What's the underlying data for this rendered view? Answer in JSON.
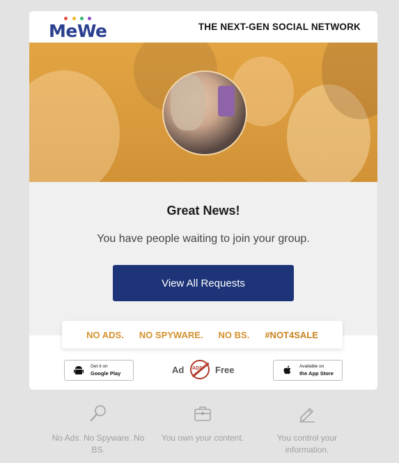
{
  "brand": {
    "logo_text": "MeWe",
    "logo_dot_colors": [
      "#e64b3c",
      "#f0b429",
      "#2db86b",
      "#8b46c9",
      "#3b82f6"
    ],
    "tagline": "THE NEXT-GEN SOCIAL NETWORK"
  },
  "hero": {
    "overlay_color": "#e3a443"
  },
  "message": {
    "headline": "Great News!",
    "body": "You have people waiting to join your group.",
    "cta_label": "View All Requests",
    "cta_color": "#1e3479"
  },
  "ribbon": {
    "items": [
      "NO ADS.",
      "NO SPYWARE.",
      "NO BS.",
      "#NOT4SALE"
    ],
    "accent_color": "#d4922e"
  },
  "badges": {
    "google_play": {
      "line1": "Get it on",
      "line2": "Google Play",
      "icon": "android-icon"
    },
    "app_store": {
      "line1": "Available on",
      "line2": "the App Store",
      "icon": "apple-icon"
    },
    "ad_free": {
      "left": "Ad",
      "stamp": "ADS",
      "right": "Free"
    }
  },
  "features": [
    {
      "icon": "search-icon",
      "text": "No Ads. No Spyware. No BS."
    },
    {
      "icon": "briefcase-icon",
      "text": "You own your content."
    },
    {
      "icon": "pencil-icon",
      "text": "You control your information."
    }
  ]
}
